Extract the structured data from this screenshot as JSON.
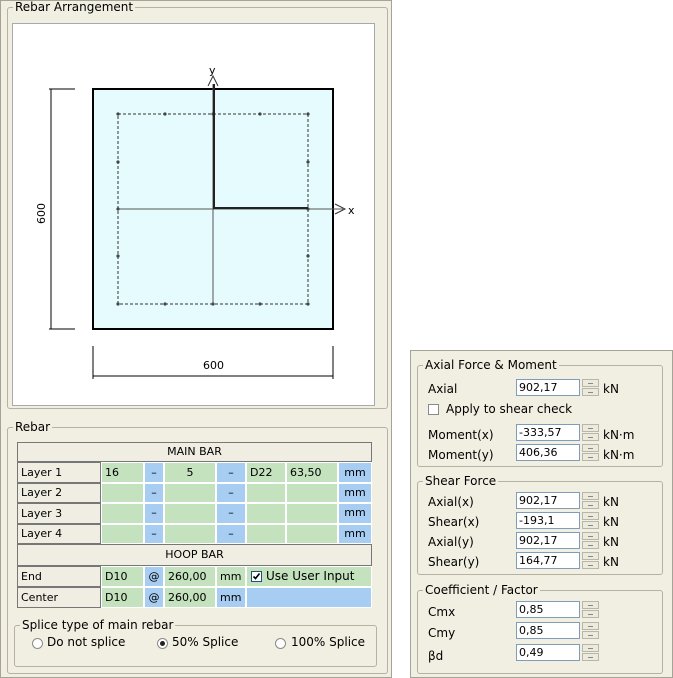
{
  "rebar_arrangement": {
    "title": "Rebar Arrangement",
    "dim_vertical": "600",
    "dim_horizontal": "600",
    "axis_y": "y",
    "axis_x": "x"
  },
  "rebar": {
    "title": "Rebar",
    "main_bar_header": "MAIN BAR",
    "hoop_bar_header": "HOOP BAR",
    "layers": [
      {
        "label": "Layer 1",
        "count": "16",
        "sep1": "–",
        "num": "5",
        "sep2": "–",
        "dia": "D22",
        "cover": "63,50",
        "unit": "mm"
      },
      {
        "label": "Layer 2",
        "count": "",
        "sep1": "–",
        "num": "",
        "sep2": "–",
        "dia": "",
        "cover": "",
        "unit": "mm"
      },
      {
        "label": "Layer 3",
        "count": "",
        "sep1": "–",
        "num": "",
        "sep2": "–",
        "dia": "",
        "cover": "",
        "unit": "mm"
      },
      {
        "label": "Layer 4",
        "count": "",
        "sep1": "–",
        "num": "",
        "sep2": "–",
        "dia": "",
        "cover": "",
        "unit": "mm"
      }
    ],
    "hoops": [
      {
        "label": "End",
        "dia": "D10",
        "at": "@",
        "spacing": "260,00",
        "unit": "mm",
        "option": "Use User Input"
      },
      {
        "label": "Center",
        "dia": "D10",
        "at": "@",
        "spacing": "260,00",
        "unit": "mm"
      }
    ]
  },
  "splice": {
    "title": "Splice type of main rebar",
    "options": [
      "Do not splice",
      "50% Splice",
      "100% Splice"
    ],
    "selected": "50% Splice"
  },
  "axial_force": {
    "title": "Axial Force & Moment",
    "axial_label": "Axial",
    "axial_value": "902,17",
    "axial_unit": "kN",
    "shear_check_label": "Apply to shear check",
    "mx_label": "Moment(x)",
    "mx_value": "-333,57",
    "mx_unit": "kN·m",
    "my_label": "Moment(y)",
    "my_value": "406,36",
    "my_unit": "kN·m"
  },
  "shear_force": {
    "title": "Shear Force",
    "rows": [
      {
        "label": "Axial(x)",
        "value": "902,17",
        "unit": "kN"
      },
      {
        "label": "Shear(x)",
        "value": "-193,1",
        "unit": "kN"
      },
      {
        "label": "Axial(y)",
        "value": "902,17",
        "unit": "kN"
      },
      {
        "label": "Shear(y)",
        "value": "164,77",
        "unit": "kN"
      }
    ]
  },
  "coefficient": {
    "title": "Coefficient / Factor",
    "rows": [
      {
        "label": "Cmx",
        "value": "0,85"
      },
      {
        "label": "Cmy",
        "value": "0,85"
      },
      {
        "label": "βd",
        "value": "0,49"
      }
    ]
  }
}
